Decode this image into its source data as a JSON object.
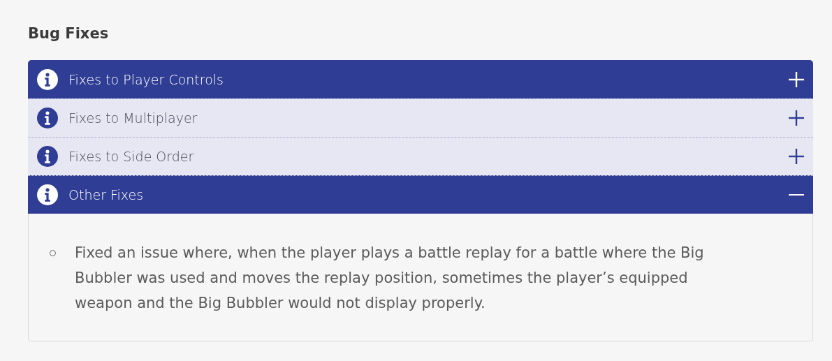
{
  "heading": "Bug Fixes",
  "sections": [
    {
      "title": "Fixes to Player Controls",
      "highlighted": true,
      "expanded": false
    },
    {
      "title": "Fixes to Multiplayer",
      "highlighted": false,
      "expanded": false
    },
    {
      "title": "Fixes to Side Order",
      "highlighted": false,
      "expanded": false
    },
    {
      "title": "Other Fixes",
      "highlighted": true,
      "expanded": true,
      "items": [
        "Fixed an issue where, when the player plays a battle replay for a battle where the Big Bubbler was used and moves the replay position, sometimes the player’s equipped weapon and the Big Bubbler would not display properly."
      ]
    }
  ]
}
